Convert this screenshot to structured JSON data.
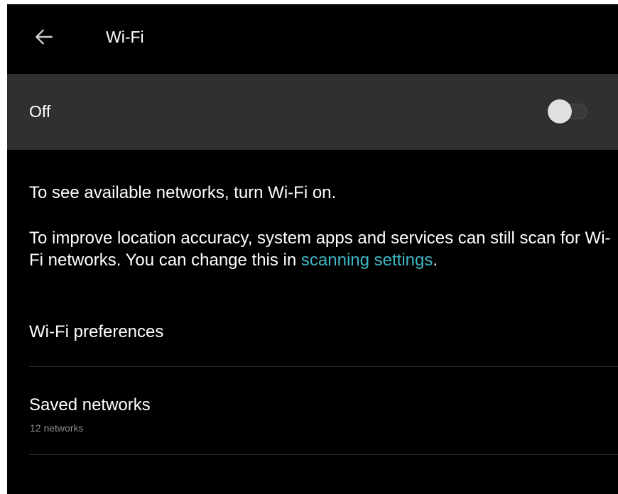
{
  "header": {
    "back_icon": "arrow-left-icon",
    "title": "Wi-Fi"
  },
  "wifi_toggle": {
    "label": "Off",
    "state": false
  },
  "info": {
    "line1": "To see available networks, turn Wi-Fi on.",
    "line2_prefix": "To improve location accuracy, system apps and services can still scan for Wi-Fi networks. You can change this in ",
    "line2_link": "scanning settings",
    "line2_suffix": "."
  },
  "items": {
    "preferences": {
      "label": "Wi-Fi preferences"
    },
    "saved_networks": {
      "label": "Saved networks",
      "summary": "12 networks"
    }
  },
  "colors": {
    "background": "#000000",
    "toggle_row_bg": "#303030",
    "link": "#3fb6c6",
    "text": "#ffffff",
    "secondary_text": "#8c8c8c"
  }
}
